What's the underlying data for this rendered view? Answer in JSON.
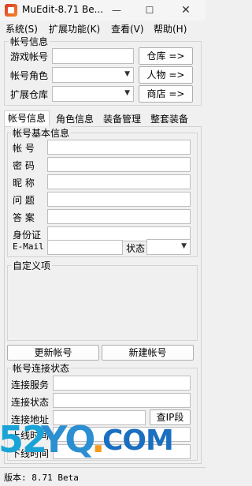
{
  "window": {
    "title": "MuEdit-8.71 Be..."
  },
  "menu": {
    "items": [
      {
        "label": "系统(S)"
      },
      {
        "label": "扩展功能(K)"
      },
      {
        "label": "查看(V)"
      },
      {
        "label": "帮助(H)"
      }
    ]
  },
  "account_box": {
    "legend": "帐号信息",
    "game_account_label": "游戏帐号",
    "game_account_value": "",
    "account_role_label": "帐号角色",
    "account_role_value": "",
    "ext_storage_label": "扩展仓库",
    "ext_storage_value": "",
    "warehouse_button": "仓库 =>",
    "character_button": "人物 =>",
    "shop_button": "商店 =>"
  },
  "tabs": [
    {
      "label": "帐号信息"
    },
    {
      "label": "角色信息"
    },
    {
      "label": "装备管理"
    },
    {
      "label": "整套装备"
    }
  ],
  "basic_info": {
    "legend": "帐号基本信息",
    "fields": [
      {
        "label": "帐    号",
        "value": ""
      },
      {
        "label": "密    码",
        "value": ""
      },
      {
        "label": "昵    称",
        "value": ""
      },
      {
        "label": "问    题",
        "value": ""
      },
      {
        "label": "答    案",
        "value": ""
      },
      {
        "label": "身份证",
        "value": ""
      }
    ],
    "email_label": "E-Mail",
    "email_value": "",
    "status_label": "状态",
    "status_value": ""
  },
  "custom": {
    "legend": "自定义项"
  },
  "actions": {
    "update_button": "更新帐号",
    "create_button": "新建帐号"
  },
  "connection": {
    "legend": "帐号连接状态",
    "service_label": "连接服务",
    "service_value": "",
    "state_label": "连接状态",
    "state_value": "",
    "address_label": "连接地址",
    "address_value": "",
    "lookup_ip_button": "查IP段",
    "online_time_label": "上线时间",
    "offline_time_label": "下线时间"
  },
  "watermark": {
    "text_num": "52",
    "text_yq": "YQ",
    "text_dot": ".",
    "text_com": "COM"
  },
  "status_bar": {
    "text": "版本: 8.71 Beta"
  }
}
